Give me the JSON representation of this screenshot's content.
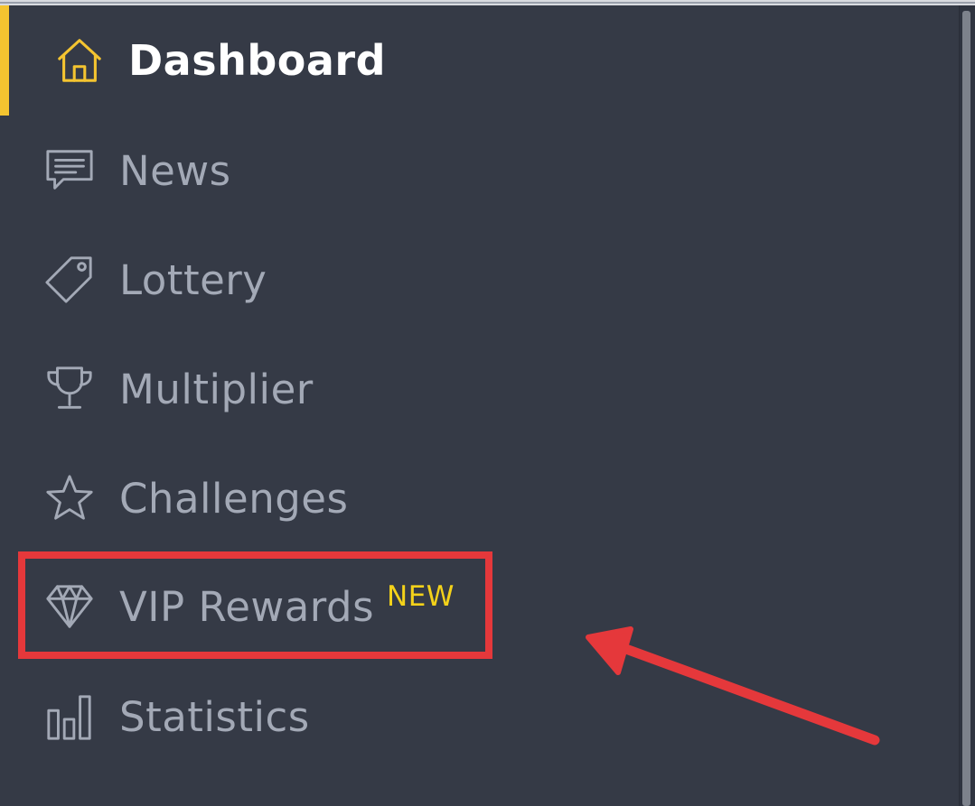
{
  "sidebar": {
    "items": [
      {
        "label": "Dashboard",
        "icon": "home-icon",
        "active": true
      },
      {
        "label": "News",
        "icon": "chat-icon",
        "active": false
      },
      {
        "label": "Lottery",
        "icon": "tag-icon",
        "active": false
      },
      {
        "label": "Multiplier",
        "icon": "trophy-icon",
        "active": false
      },
      {
        "label": "Challenges",
        "icon": "star-icon",
        "active": false
      },
      {
        "label": "VIP Rewards",
        "icon": "diamond-icon",
        "active": false,
        "badge": "NEW"
      },
      {
        "label": "Statistics",
        "icon": "bar-chart-icon",
        "active": false
      }
    ]
  },
  "colors": {
    "background": "#353a46",
    "accent": "#f4c430",
    "badge": "#f4d21a",
    "inactive_text": "#a3a9b6",
    "active_text": "#ffffff",
    "annotation": "#e5383b"
  }
}
